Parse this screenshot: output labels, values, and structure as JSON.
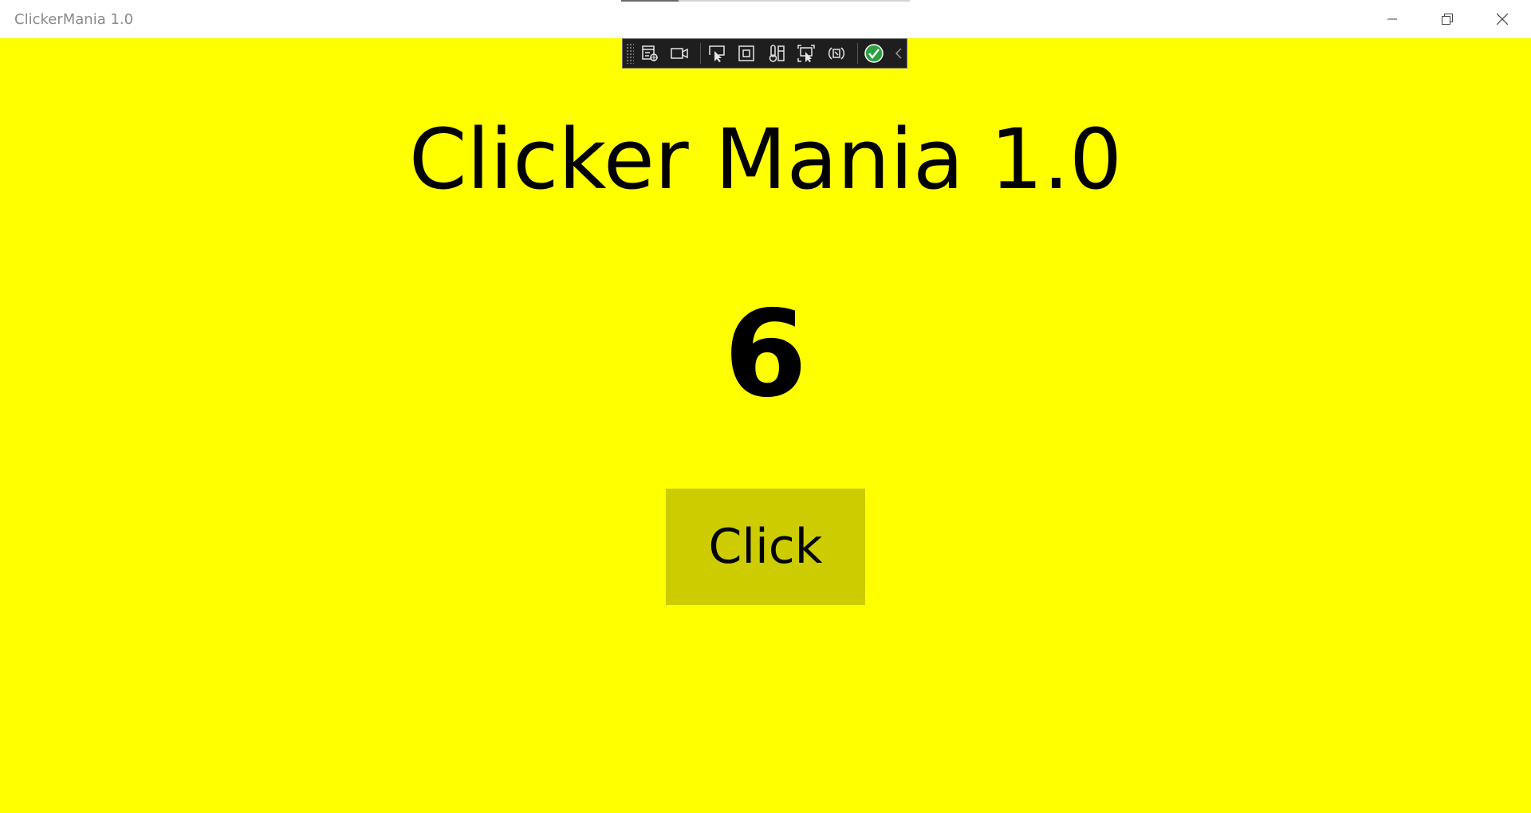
{
  "window": {
    "title": "ClickerMania 1.0"
  },
  "app": {
    "heading": "Clicker Mania 1.0",
    "counter": "6",
    "click_label": "Click"
  },
  "devtools": {
    "tools": [
      "live-visual-tree-icon",
      "record-icon",
      "select-element-icon",
      "display-layout-adorners-icon",
      "track-focus-icon",
      "preview-selection-icon",
      "hot-reload-icon",
      "binding-failures-ok-icon"
    ]
  },
  "colors": {
    "background": "#ffff00",
    "button": "#cccc00",
    "text": "#000000",
    "toolbar": "#1e1e1e",
    "check": "#2ea043"
  }
}
